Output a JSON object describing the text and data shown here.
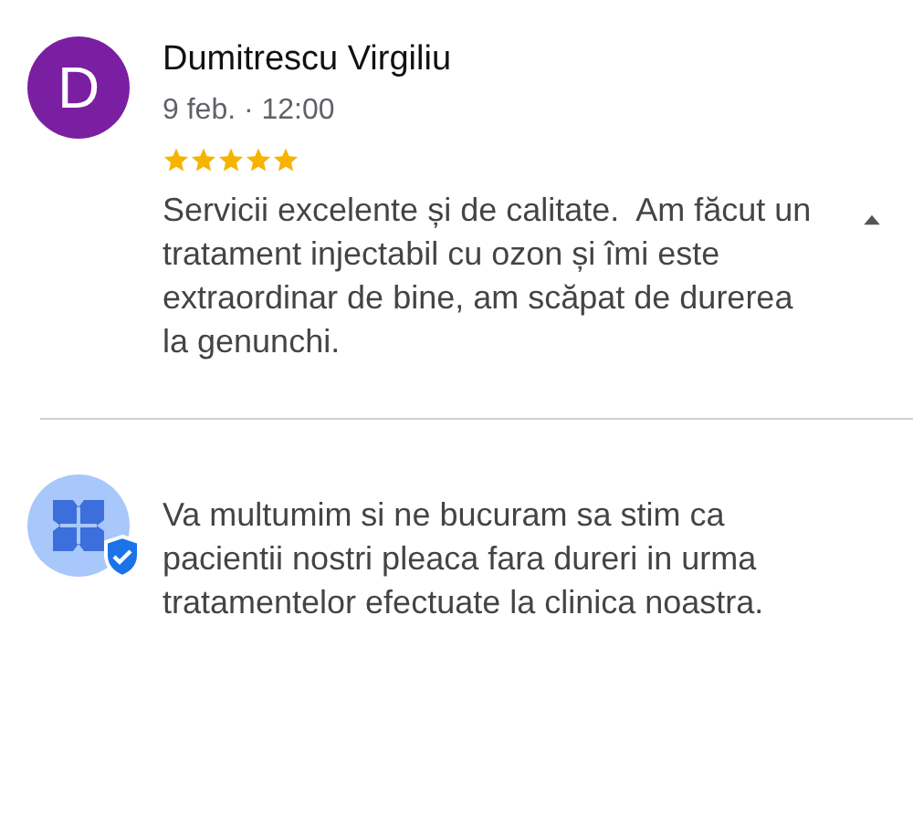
{
  "review": {
    "avatar_letter": "D",
    "color": "#7b1fa2",
    "author": "Dumitrescu Virgiliu",
    "date": "9 feb. · 12:00",
    "stars": 5,
    "text": "Servicii excelente și de calitate.  Am făcut un tratament injectabil cu ozon și îmi este extraordinar de bine, am scăpat de durerea la genunchi.",
    "expanded": true
  },
  "owner_reply": {
    "text": "Va multumim si ne bucuram sa stim ca pacientii nostri pleaca fara dureri in urma tratamentelor efectuate la clinica noastra.",
    "verified": true
  }
}
